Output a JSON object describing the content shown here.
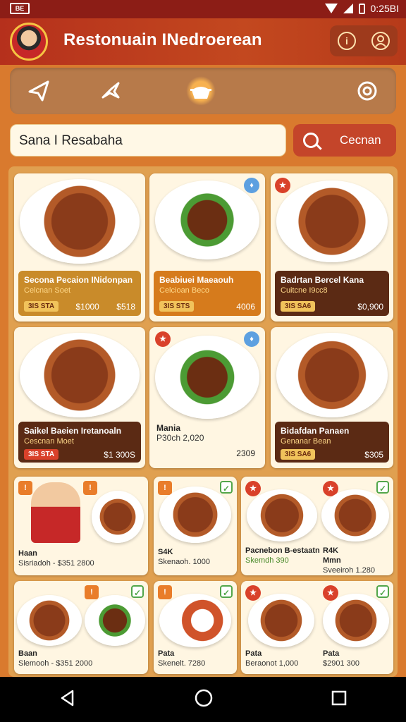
{
  "status": {
    "left_icon": "BE",
    "time": "0:25BI"
  },
  "appbar": {
    "title": "Restonuain INedroerean",
    "info_icon": "i"
  },
  "categories": [
    {
      "name": "kite-icon"
    },
    {
      "name": "bird-icon"
    },
    {
      "name": "dish-icon",
      "active": true
    },
    {
      "name": "camera-icon"
    }
  ],
  "search": {
    "value": "Sana I Resabaha",
    "button_label": "Cecnan"
  },
  "cards_large": [
    {
      "name": "Secona Pecaion INidonpan",
      "sub": "Celcnan Soet",
      "tag": "3IS STA",
      "price": "$1000",
      "alt_price": "$518"
    },
    {
      "name": "Beabiuei Maeaouh",
      "sub": "Celcioan Beco",
      "tag": "3IS STS",
      "price": "4006"
    },
    {
      "name": "Badrtan Bercel Kana",
      "sub": "Cuitcne I9cc8",
      "tag": "3IS SA6",
      "price": "$0,900"
    },
    {
      "name": "Saikel Baeien Iretanoaln",
      "sub": "Cescnan Moet",
      "tag": "3IS STA",
      "price": "$1 300S"
    },
    {
      "name": "Mania",
      "sub": "P30ch 2,020",
      "price": "2309"
    },
    {
      "name": "Bidafdan Panaen",
      "sub": "Genanar Bean",
      "tag": "3IS SA6",
      "price": "$305"
    }
  ],
  "cards_small_row1": [
    {
      "line1": "Haan",
      "line2": "Sisriadoh - $351 2800"
    },
    {
      "line1": "S4K",
      "line2": "Skenaoh. 1000"
    },
    {
      "line1": "Pacnebon B-estaatn",
      "line2": "Skemdh 390"
    },
    {
      "line1": "R4K",
      "line2": "Mmn",
      "line3": "Sveeiroh 1.280"
    }
  ],
  "cards_small_row2": [
    {
      "line1": "Baan",
      "line2": "Slemooh - $351 2000"
    },
    {
      "line1": "Pata",
      "line2": "Skenelt. 7280"
    },
    {
      "line1": "Pata",
      "line2": "Beraonot 1,000"
    },
    {
      "line1": "Pata",
      "line2": "$2901 300"
    }
  ]
}
